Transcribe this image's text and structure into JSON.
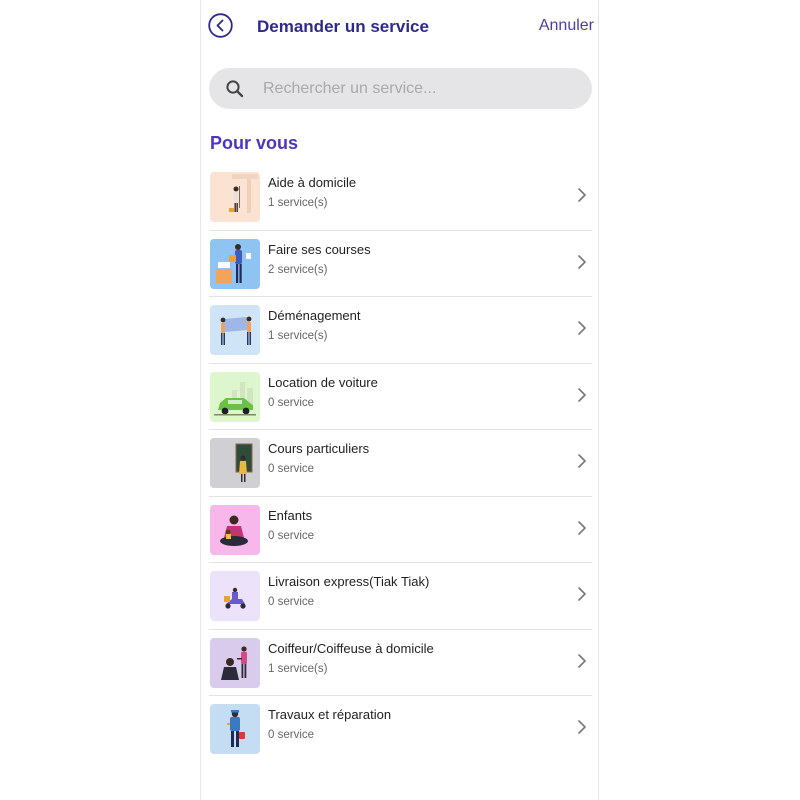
{
  "header": {
    "title": "Demander un service",
    "cancel_label": "Annuler",
    "back_icon": "chevron-left-circle-icon"
  },
  "search": {
    "placeholder": "Rechercher un service...",
    "value": "",
    "icon": "search-icon"
  },
  "section": {
    "title": "Pour vous"
  },
  "colors": {
    "primary_dark": "#2d2a8c",
    "accent": "#4b35c4",
    "search_bg": "#e5e4e6"
  },
  "services": [
    {
      "title": "Aide à domicile",
      "count": "1 service(s)",
      "thumb_bg": "#fbe3d3",
      "icon": "cleaning-person-icon"
    },
    {
      "title": "Faire ses courses",
      "count": "2 service(s)",
      "thumb_bg": "#8fc3f2",
      "icon": "shopping-person-icon"
    },
    {
      "title": "Déménagement",
      "count": "1 service(s)",
      "thumb_bg": "#cfe4f6",
      "icon": "movers-icon"
    },
    {
      "title": "Location de voiture",
      "count": "0 service",
      "thumb_bg": "#ddf6cd",
      "icon": "green-car-icon"
    },
    {
      "title": "Cours particuliers",
      "count": "0 service",
      "thumb_bg": "#cfcfd4",
      "icon": "teacher-icon"
    },
    {
      "title": "Enfants",
      "count": "0 service",
      "thumb_bg": "#f7b7ea",
      "icon": "mother-child-icon"
    },
    {
      "title": "Livraison express(Tiak Tiak)",
      "count": "0 service",
      "thumb_bg": "#ece2f9",
      "icon": "scooter-delivery-icon"
    },
    {
      "title": "Coiffeur/Coiffeuse à domicile",
      "count": "1 service(s)",
      "thumb_bg": "#d9cbec",
      "icon": "hairdresser-icon"
    },
    {
      "title": "Travaux et réparation",
      "count": "0 service",
      "thumb_bg": "#c4ddf2",
      "icon": "repairman-icon"
    }
  ]
}
